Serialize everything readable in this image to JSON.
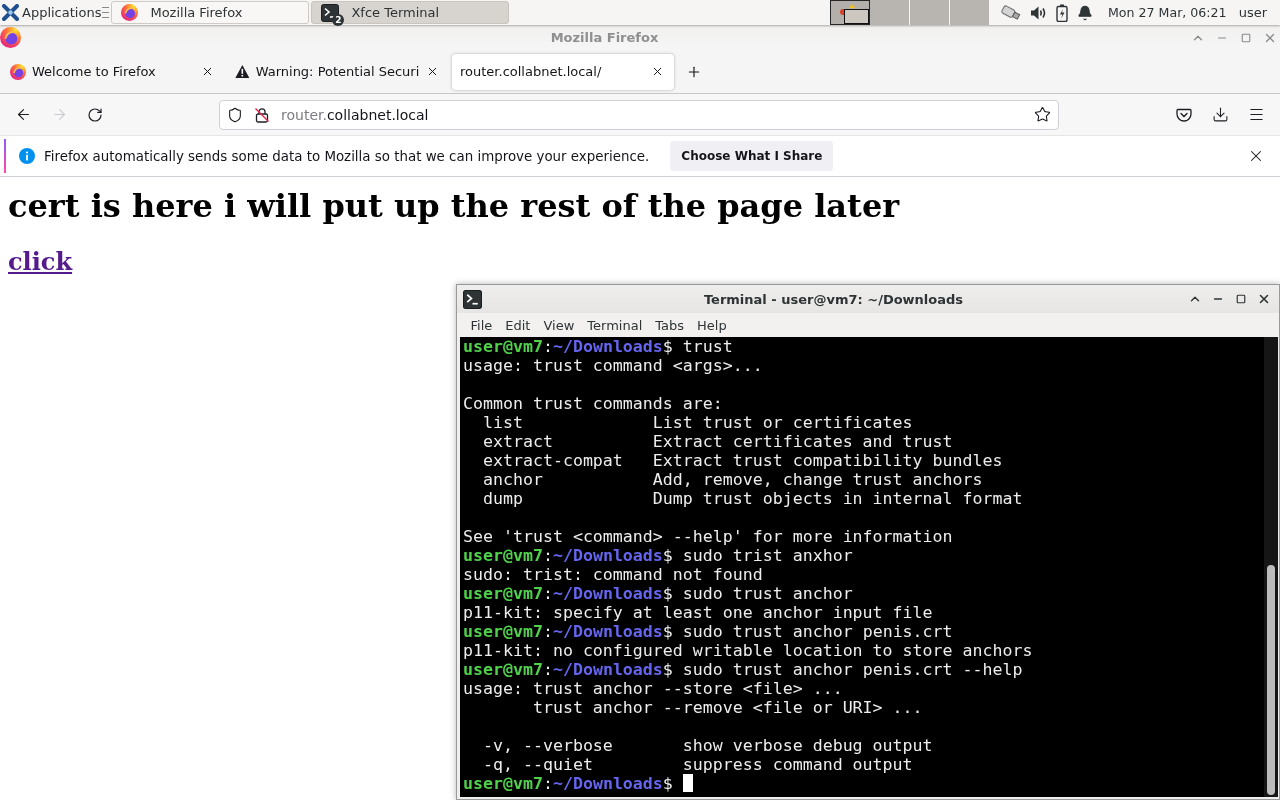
{
  "panel": {
    "applications": "Applications",
    "tasks": [
      {
        "kind": "browser",
        "label": "Mozilla Firefox",
        "selected": false
      },
      {
        "kind": "terminal",
        "label": "Xfce Terminal",
        "count": "2",
        "selected": true
      }
    ],
    "workspaces": [
      {
        "selected": true
      },
      {
        "selected": false
      },
      {
        "selected": false
      },
      {
        "selected": false
      }
    ],
    "clock": "Mon 27 Mar, 06:21",
    "user": "user"
  },
  "browser": {
    "title": "Mozilla Firefox",
    "tabs": [
      {
        "kind": "browser",
        "label": "Welcome to Firefox",
        "selected": false
      },
      {
        "kind": "warning",
        "label": "Warning: Potential Securi",
        "selected": false
      },
      {
        "kind": "plain",
        "label": "router.collabnet.local/",
        "selected": true
      }
    ],
    "nav_buttons": [
      {
        "kind": "back",
        "disabled": false
      },
      {
        "kind": "forward",
        "disabled": true
      },
      {
        "kind": "reload",
        "disabled": false
      }
    ],
    "address": {
      "subdomain": "router.",
      "domain": "collabnet.local"
    },
    "notification": {
      "text": "Firefox automatically sends some data to Mozilla so that we can improve your experience.",
      "button": "Choose What I Share"
    },
    "page": {
      "heading": "cert is here i will put up the rest of the page later",
      "link": "click"
    }
  },
  "terminal": {
    "title": "Terminal - user@vm7: ~/Downloads",
    "menu": [
      "File",
      "Edit",
      "View",
      "Terminal",
      "Tabs",
      "Help"
    ],
    "lines": [
      {
        "kind": "prompt",
        "user": "user@vm7",
        "separator": ":",
        "path": "~/Downloads",
        "symbol": "$",
        "command": "trust"
      },
      {
        "kind": "output",
        "text": "usage: trust command <args>..."
      },
      {
        "kind": "blank"
      },
      {
        "kind": "output",
        "text": "Common trust commands are:"
      },
      {
        "kind": "output",
        "text": "  list             List trust or certificates"
      },
      {
        "kind": "output",
        "text": "  extract          Extract certificates and trust"
      },
      {
        "kind": "output",
        "text": "  extract-compat   Extract trust compatibility bundles"
      },
      {
        "kind": "output",
        "text": "  anchor           Add, remove, change trust anchors"
      },
      {
        "kind": "output",
        "text": "  dump             Dump trust objects in internal format"
      },
      {
        "kind": "blank"
      },
      {
        "kind": "output",
        "text": "See 'trust <command> --help' for more information"
      },
      {
        "kind": "prompt",
        "user": "user@vm7",
        "separator": ":",
        "path": "~/Downloads",
        "symbol": "$",
        "command": "sudo trist anxhor"
      },
      {
        "kind": "output",
        "text": "sudo: trist: command not found"
      },
      {
        "kind": "prompt",
        "user": "user@vm7",
        "separator": ":",
        "path": "~/Downloads",
        "symbol": "$",
        "command": "sudo trust anchor"
      },
      {
        "kind": "output",
        "text": "p11-kit: specify at least one anchor input file"
      },
      {
        "kind": "prompt",
        "user": "user@vm7",
        "separator": ":",
        "path": "~/Downloads",
        "symbol": "$",
        "command": "sudo trust anchor penis.crt"
      },
      {
        "kind": "output",
        "text": "p11-kit: no configured writable location to store anchors"
      },
      {
        "kind": "prompt",
        "user": "user@vm7",
        "separator": ":",
        "path": "~/Downloads",
        "symbol": "$",
        "command": "sudo trust anchor penis.crt --help"
      },
      {
        "kind": "output",
        "text": "usage: trust anchor --store <file> ..."
      },
      {
        "kind": "output",
        "text": "       trust anchor --remove <file or URI> ..."
      },
      {
        "kind": "blank"
      },
      {
        "kind": "output",
        "text": "  -v, --verbose       show verbose debug output"
      },
      {
        "kind": "output",
        "text": "  -q, --quiet         suppress command output"
      },
      {
        "kind": "prompt",
        "user": "user@vm7",
        "separator": ":",
        "path": "~/Downloads",
        "symbol": "$",
        "cursor": true
      }
    ]
  }
}
